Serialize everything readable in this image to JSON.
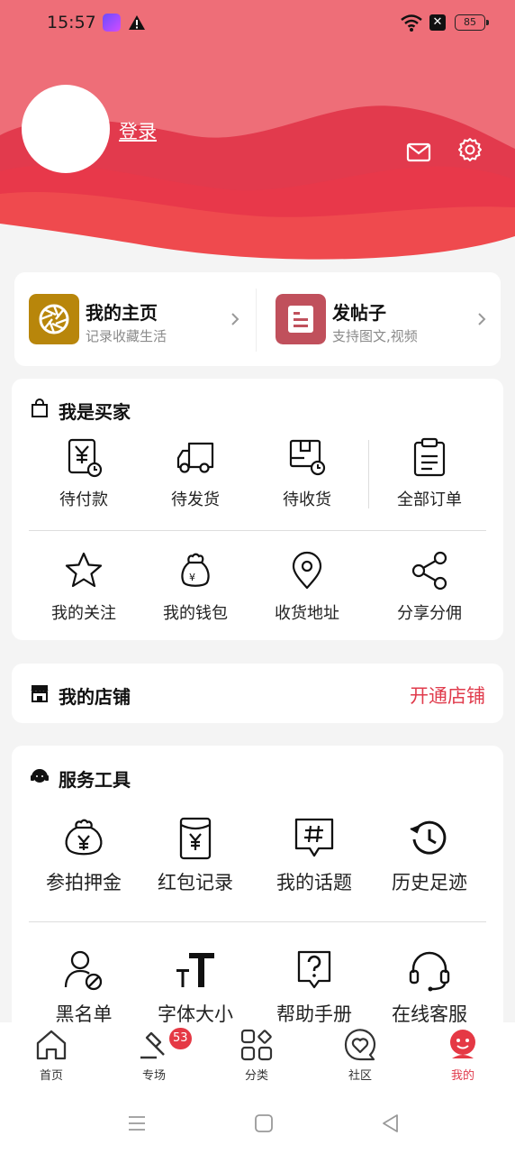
{
  "status_bar": {
    "time": "15:57",
    "battery": "85",
    "x_icon": "✕"
  },
  "profile": {
    "login_label": "登录"
  },
  "quick": [
    {
      "title": "我的主页",
      "subtitle": "记录收藏生活",
      "icon": "aperture-icon",
      "color": "#b8860b"
    },
    {
      "title": "发帖子",
      "subtitle": "支持图文,视频",
      "icon": "post-icon",
      "color": "#c0505c"
    }
  ],
  "buyer": {
    "title": "我是买家",
    "orders": [
      {
        "label": "待付款",
        "icon": "pending-payment-icon"
      },
      {
        "label": "待发货",
        "icon": "truck-icon"
      },
      {
        "label": "待收货",
        "icon": "package-clock-icon"
      },
      {
        "label": "全部订单",
        "icon": "clipboard-icon"
      }
    ],
    "links": [
      {
        "label": "我的关注",
        "icon": "star-icon"
      },
      {
        "label": "我的钱包",
        "icon": "money-bag-icon"
      },
      {
        "label": "收货地址",
        "icon": "location-pin-icon"
      },
      {
        "label": "分享分佣",
        "icon": "share-icon"
      }
    ]
  },
  "shop": {
    "title": "我的店铺",
    "link": "开通店铺"
  },
  "tools": {
    "title": "服务工具",
    "row1": [
      {
        "label": "参拍押金",
        "icon": "deposit-bag-icon"
      },
      {
        "label": "红包记录",
        "icon": "red-packet-icon"
      },
      {
        "label": "我的话题",
        "icon": "topic-icon"
      },
      {
        "label": "历史足迹",
        "icon": "history-icon"
      }
    ],
    "row2": [
      {
        "label": "黑名单",
        "icon": "blocked-user-icon"
      },
      {
        "label": "字体大小",
        "icon": "font-size-icon"
      },
      {
        "label": "帮助手册",
        "icon": "help-icon"
      },
      {
        "label": "在线客服",
        "icon": "headset-icon"
      }
    ]
  },
  "nav": {
    "items": [
      {
        "label": "首页",
        "icon": "home-icon"
      },
      {
        "label": "专场",
        "icon": "auction-hammer-icon"
      },
      {
        "label": "分类",
        "icon": "category-icon"
      },
      {
        "label": "社区",
        "icon": "community-heart-icon"
      },
      {
        "label": "我的",
        "icon": "mine-face-icon"
      }
    ],
    "badge": "53",
    "active_color": "#e03b4c"
  }
}
